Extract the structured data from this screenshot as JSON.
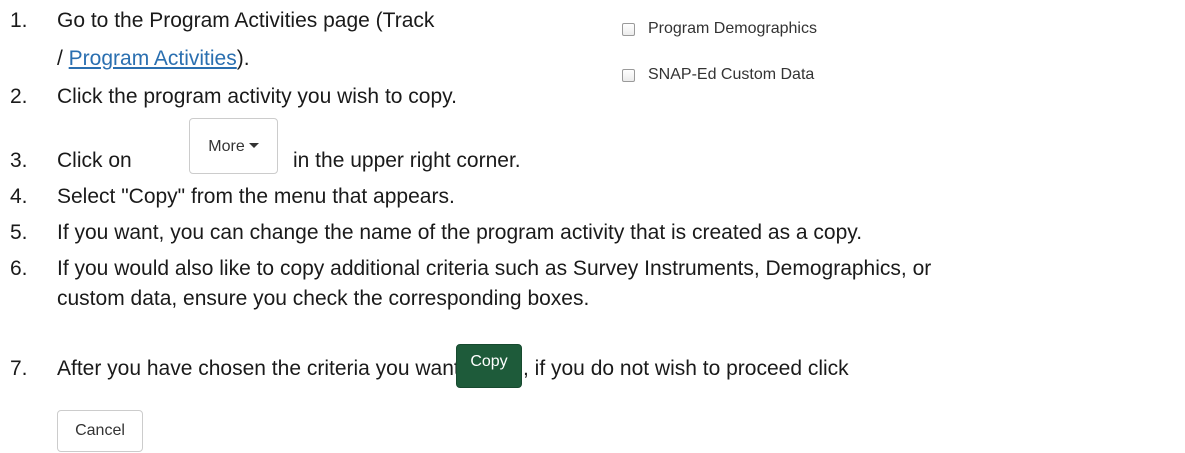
{
  "steps": [
    {
      "number": "1.",
      "line1": "Go to the Program Activities page (Track",
      "line2_prefix": "/ ",
      "link": "Program Activities",
      "line2_suffix": ")."
    },
    {
      "number": "2.",
      "text": "Click the program activity you wish to copy."
    },
    {
      "number": "3.",
      "prefix": "Click on",
      "suffix": "in the upper right corner."
    },
    {
      "number": "4.",
      "text": "Select \"Copy\" from the menu that appears."
    },
    {
      "number": "5.",
      "text": "If you want, you can change the name of the program activity that is created as a copy."
    },
    {
      "number": "6.",
      "line1": "If you would also like to copy additional criteria such as Survey Instruments, Demographics, or",
      "line2": "custom data, ensure you check the corresponding boxes."
    },
    {
      "number": "7.",
      "prefix": "After you have chosen the criteria you want, click",
      "suffix": ", if you do not wish to proceed click"
    }
  ],
  "checkboxes": [
    {
      "label": "Program Demographics",
      "checked": false
    },
    {
      "label": "SNAP-Ed Custom Data",
      "checked": false
    }
  ],
  "buttons": {
    "more_label": "More",
    "copy_label": "Copy",
    "cancel_label": "Cancel"
  },
  "colors": {
    "text": "#1a1a1a",
    "link": "#2a6fb0",
    "copy_button": "#1e5b3a"
  }
}
